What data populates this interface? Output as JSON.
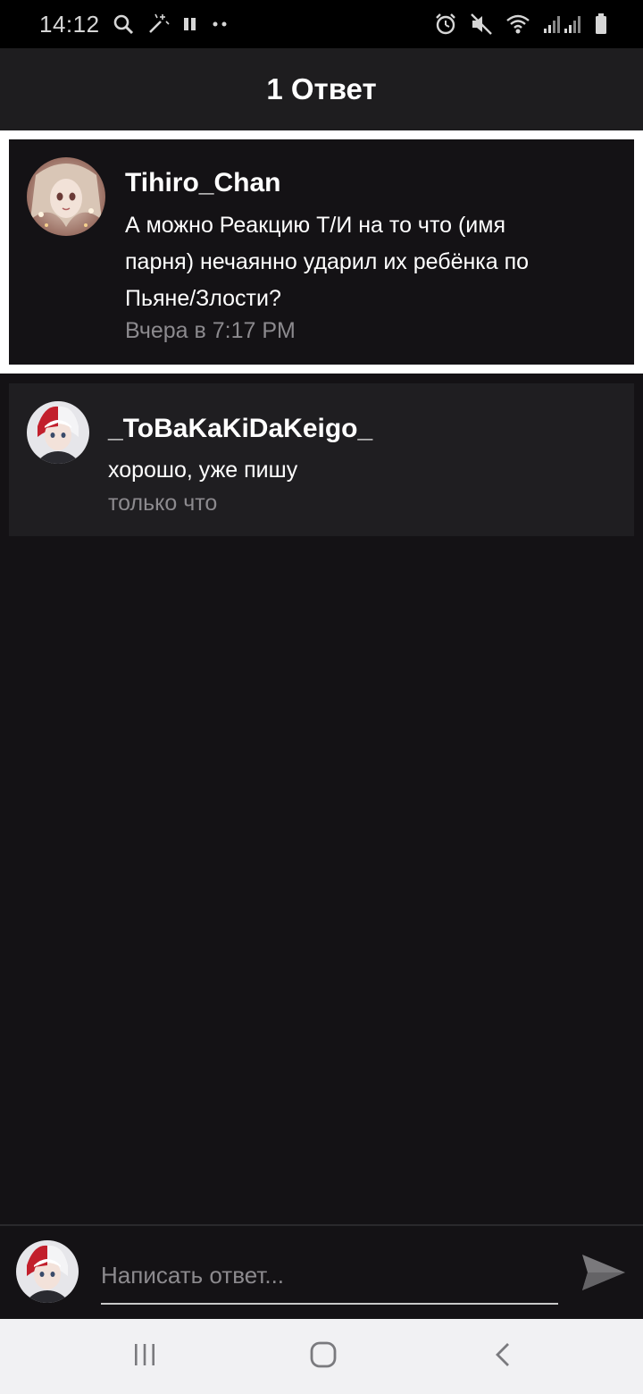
{
  "status_bar": {
    "time": "14:12",
    "left_icons": [
      "search-icon",
      "magic-wand-icon",
      "pause-icon",
      "more-dots-icon"
    ],
    "right_icons": [
      "alarm-icon",
      "mute-icon",
      "wifi-icon",
      "signal-icon",
      "battery-icon"
    ]
  },
  "header": {
    "title": "1 Ответ"
  },
  "original_comment": {
    "username": "Tihiro_Chan",
    "text_lines": [
      "А можно Реакцию Т/И на то что (имя",
      "парня) нечаянно ударил их ребёнка по",
      "Пьяне/Злости?"
    ],
    "time": "Вчера в 7:17 PM",
    "highlight_color": "#ffffff"
  },
  "reply": {
    "username": "_ToBaKaKiDaKeigo_",
    "text": "хорошо,  уже пишу",
    "time": "только что"
  },
  "compose": {
    "placeholder": "Написать ответ...",
    "send_icon": "send-icon"
  },
  "nav_bar": {
    "buttons": [
      "recent-apps-icon",
      "home-icon",
      "back-icon"
    ]
  },
  "colors": {
    "background": "#141215",
    "header": "#1e1d1f",
    "reply_card": "#1f1e21",
    "muted_text": "#8c8a8e"
  }
}
